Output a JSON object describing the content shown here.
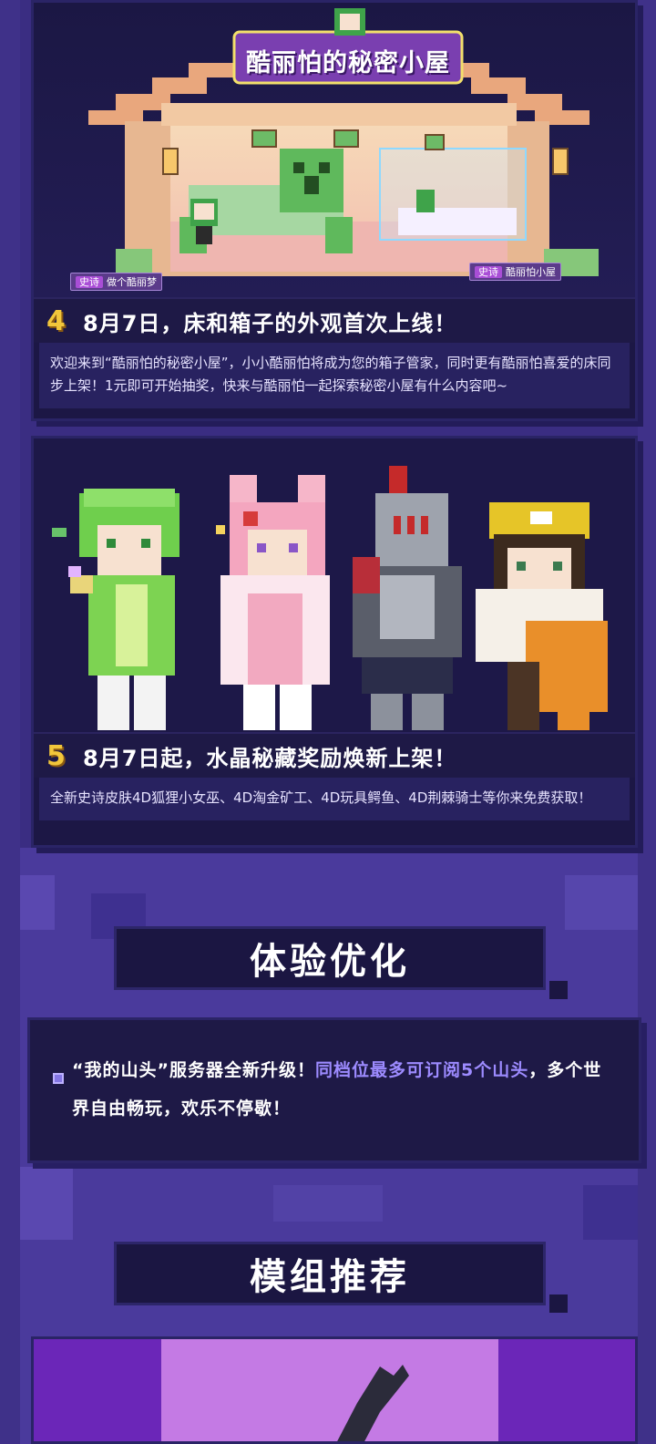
{
  "section4": {
    "number": "4",
    "headline": "8月7日，床和箱子的外观首次上线！",
    "description": "欢迎来到“酷丽怕的秘密小屋”，小小酷丽怕将成为您的箱子管家，同时更有酷丽怕喜爱的床同步上架！1元即可开始抽奖，快来与酷丽怕一起探索秘密小屋有什么内容吧~",
    "banner_title": "酷丽怕的秘密小屋",
    "tag_left": {
      "rarity": "史诗",
      "name": "做个酷丽梦"
    },
    "tag_right": {
      "rarity": "史诗",
      "name": "酷丽怕小屋"
    }
  },
  "section5": {
    "number": "5",
    "headline": "8月7日起，水晶秘藏奖励焕新上架！",
    "description": "全新史诗皮肤4D狐狸小女巫、4D淘金矿工、4D玩具鳄鱼、4D荆棘骑士等你来免费获取！"
  },
  "experience": {
    "title": "体验优化",
    "text_before": "“我的山头”服务器全新升级！",
    "text_highlight": "同档位最多可订阅5个山头",
    "text_after": "，多个世界自由畅玩，欢乐不停歇！"
  },
  "mods": {
    "title": "模组推荐"
  },
  "colors": {
    "background": "#3d2f86",
    "card": "#1c1745",
    "accent_number": "#f2c63b",
    "highlight_text": "#9d8bff"
  }
}
